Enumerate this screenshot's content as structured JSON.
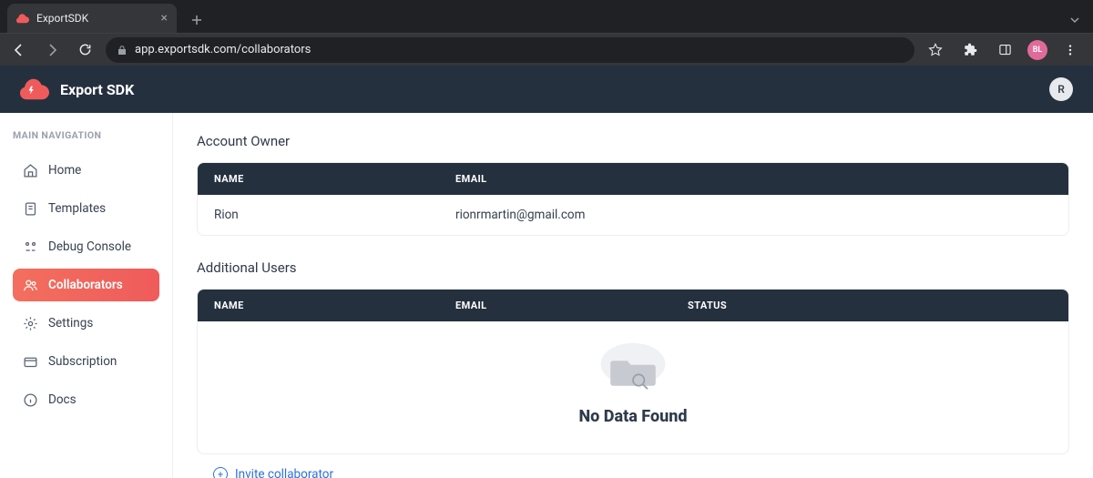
{
  "browser": {
    "tab_title": "ExportSDK",
    "url": "app.exportsdk.com/collaborators",
    "profile_initials": "BL"
  },
  "header": {
    "brand": "Export SDK",
    "avatar_initial": "R"
  },
  "sidebar": {
    "heading": "MAIN NAVIGATION",
    "items": [
      {
        "label": "Home"
      },
      {
        "label": "Templates"
      },
      {
        "label": "Debug Console"
      },
      {
        "label": "Collaborators"
      },
      {
        "label": "Settings"
      },
      {
        "label": "Subscription"
      },
      {
        "label": "Docs"
      }
    ]
  },
  "owner_section": {
    "title": "Account Owner",
    "columns": {
      "name": "NAME",
      "email": "EMAIL"
    },
    "row": {
      "name": "Rion",
      "email": "rionrmartin@gmail.com"
    }
  },
  "users_section": {
    "title": "Additional Users",
    "columns": {
      "name": "NAME",
      "email": "EMAIL",
      "status": "STATUS"
    },
    "empty_text": "No Data Found"
  },
  "invite_label": "Invite collaborator"
}
